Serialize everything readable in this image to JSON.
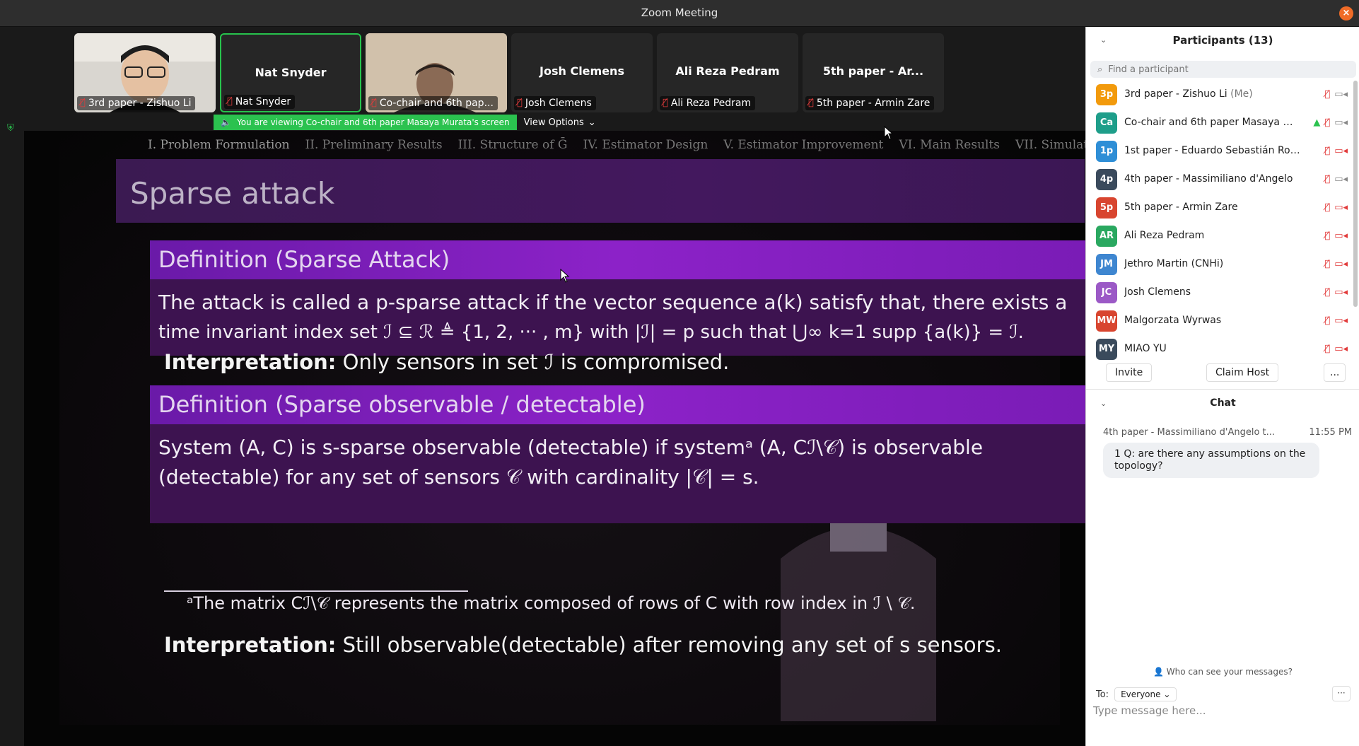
{
  "window": {
    "title": "Zoom Meeting",
    "close_icon": "×"
  },
  "thumbnails": [
    {
      "label": "3rd paper - Zishuo Li",
      "name": "",
      "has_video": true,
      "muted": true,
      "active": false
    },
    {
      "label": "Nat Snyder",
      "name": "Nat Snyder",
      "has_video": false,
      "muted": true,
      "active": true
    },
    {
      "label": "Co-chair and 6th pap...",
      "name": "",
      "has_video": true,
      "muted": true,
      "active": false
    },
    {
      "label": "Josh Clemens",
      "name": "Josh Clemens",
      "has_video": false,
      "muted": true,
      "active": false
    },
    {
      "label": "Ali Reza Pedram",
      "name": "Ali Reza Pedram",
      "has_video": false,
      "muted": true,
      "active": false
    },
    {
      "label": "5th paper - Armin Zare",
      "name": "5th paper - Ar...",
      "has_video": false,
      "muted": true,
      "active": false
    }
  ],
  "share_bar": {
    "notice": "You are viewing Co-chair and 6th paper Masaya Murata's screen",
    "view_options": "View Options"
  },
  "slide": {
    "nav": [
      "I. Problem Formulation",
      "II. Preliminary Results",
      "III. Structure of Ḡ",
      "IV. Estimator Design",
      "V. Estimator Improvement",
      "VI. Main Results",
      "VII. Simulation"
    ],
    "title": "Sparse attack",
    "def1_title": "Definition (Sparse Attack)",
    "def1_line1": "The attack is called a p-sparse attack if the vector sequence a(k) satisfy that, there exists a",
    "def1_line2": "time invariant index set ℐ ⊆ ℛ ≜ {1, 2, ··· , m} with |ℐ| = p such that ⋃∞ k=1 supp {a(k)} = ℐ.",
    "interp1_label": "Interpretation:",
    "interp1_text": "Only sensors in set ℐ is compromised.",
    "def2_title": "Definition (Sparse observable / detectable)",
    "def2_line1": "System (A, C) is s-sparse observable (detectable) if systemᵃ (A, Cℐ\\𝒞) is observable",
    "def2_line2": "(detectable) for any set of sensors 𝒞 with cardinality |𝒞| = s.",
    "footnote": "ᵃThe matrix Cℐ\\𝒞 represents the matrix composed of rows of C with row index in ℐ \\ 𝒞.",
    "interp2_label": "Interpretation:",
    "interp2_text": "Still observable(detectable) after removing any set of s sensors."
  },
  "participants_panel": {
    "title": "Participants (13)",
    "search_placeholder": "Find a participant",
    "participants": [
      {
        "initials": "3p",
        "name": "3rd paper - Zishuo Li",
        "me": "(Me)",
        "color": "#f29a0c",
        "mic_muted": true,
        "cam_off": false,
        "sharing": false
      },
      {
        "initials": "Ca",
        "name": "Co-chair and 6th paper Masaya Mu...",
        "me": "",
        "color": "#1e9e8a",
        "mic_muted": true,
        "cam_off": false,
        "sharing": true
      },
      {
        "initials": "1p",
        "name": "1st paper - Eduardo Sebastián Rodrígu...",
        "me": "",
        "color": "#2e8ed6",
        "mic_muted": true,
        "cam_off": true,
        "sharing": false
      },
      {
        "initials": "4p",
        "name": "4th paper - Massimiliano d'Angelo",
        "me": "",
        "color": "#3a4a5c",
        "mic_muted": true,
        "cam_off": false,
        "sharing": false
      },
      {
        "initials": "5p",
        "name": "5th paper - Armin Zare",
        "me": "",
        "color": "#d8452f",
        "mic_muted": true,
        "cam_off": true,
        "sharing": false
      },
      {
        "initials": "AR",
        "name": "Ali Reza Pedram",
        "me": "",
        "color": "#2aa860",
        "mic_muted": true,
        "cam_off": true,
        "sharing": false
      },
      {
        "initials": "JM",
        "name": "Jethro Martin (CNHi)",
        "me": "",
        "color": "#3e86d0",
        "mic_muted": true,
        "cam_off": true,
        "sharing": false
      },
      {
        "initials": "JC",
        "name": "Josh Clemens",
        "me": "",
        "color": "#9b59c6",
        "mic_muted": true,
        "cam_off": true,
        "sharing": false
      },
      {
        "initials": "MW",
        "name": "Malgorzata Wyrwas",
        "me": "",
        "color": "#d8452f",
        "mic_muted": true,
        "cam_off": true,
        "sharing": false
      },
      {
        "initials": "MY",
        "name": "MIAO YU",
        "me": "",
        "color": "#3a4a5c",
        "mic_muted": true,
        "cam_off": true,
        "sharing": false
      }
    ],
    "invite_label": "Invite",
    "claim_host_label": "Claim Host",
    "more_label": "..."
  },
  "chat": {
    "title": "Chat",
    "messages": [
      {
        "sender": "4th paper - Massimiliano d'Angelo t...",
        "time": "11:55 PM",
        "text": "1 Q: are there any assumptions on the topology?"
      }
    ],
    "who_can_see": "Who can see your messages?",
    "to_label": "To:",
    "to_value": "Everyone",
    "more_label": "···",
    "compose_placeholder": "Type message here..."
  }
}
